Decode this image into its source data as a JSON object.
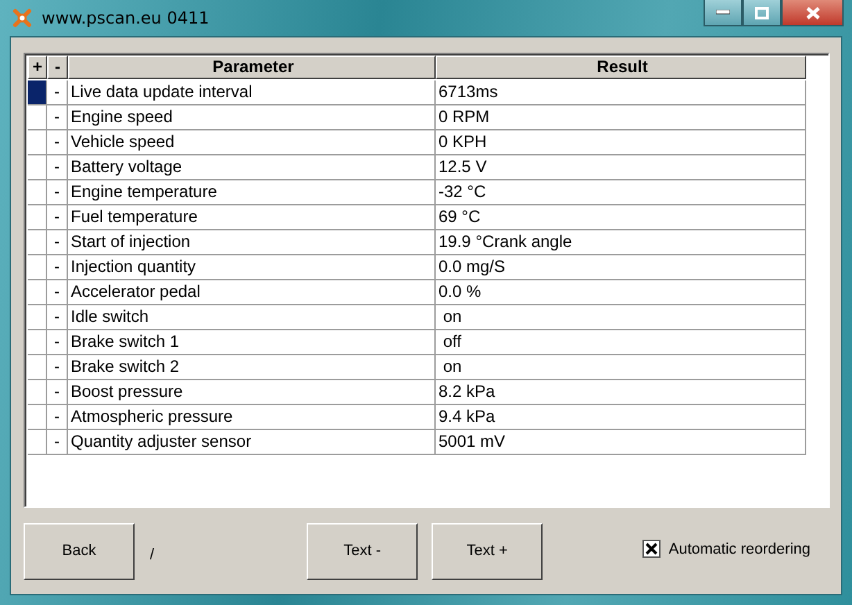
{
  "window": {
    "title": "www.pscan.eu 0411"
  },
  "table": {
    "columns": [
      "+",
      "-",
      "Parameter",
      "Result"
    ],
    "rows": [
      {
        "selected": true,
        "toggle": "-",
        "parameter": "Live data update interval",
        "result": "6713ms"
      },
      {
        "selected": false,
        "toggle": "-",
        "parameter": "Engine speed",
        "result": "0 RPM"
      },
      {
        "selected": false,
        "toggle": "-",
        "parameter": "Vehicle speed",
        "result": "0 KPH"
      },
      {
        "selected": false,
        "toggle": "-",
        "parameter": "Battery voltage",
        "result": "12.5 V"
      },
      {
        "selected": false,
        "toggle": "-",
        "parameter": "Engine temperature",
        "result": "-32 °C"
      },
      {
        "selected": false,
        "toggle": "-",
        "parameter": "Fuel temperature",
        "result": "69 °C"
      },
      {
        "selected": false,
        "toggle": "-",
        "parameter": "Start of injection",
        "result": "19.9 °Crank angle"
      },
      {
        "selected": false,
        "toggle": "-",
        "parameter": "Injection quantity",
        "result": "0.0 mg/S"
      },
      {
        "selected": false,
        "toggle": "-",
        "parameter": "Accelerator pedal",
        "result": "0.0 %"
      },
      {
        "selected": false,
        "toggle": "-",
        "parameter": "Idle switch",
        "result": " on"
      },
      {
        "selected": false,
        "toggle": "-",
        "parameter": "Brake switch 1",
        "result": " off"
      },
      {
        "selected": false,
        "toggle": "-",
        "parameter": "Brake switch 2",
        "result": " on"
      },
      {
        "selected": false,
        "toggle": "-",
        "parameter": "Boost pressure",
        "result": "8.2 kPa"
      },
      {
        "selected": false,
        "toggle": "-",
        "parameter": "Atmospheric pressure",
        "result": "9.4 kPa"
      },
      {
        "selected": false,
        "toggle": "-",
        "parameter": "Quantity adjuster sensor",
        "result": "5001 mV"
      }
    ]
  },
  "buttons": {
    "back": "Back",
    "separator": "/",
    "text_minus": "Text -",
    "text_plus": "Text +"
  },
  "auto_reorder": {
    "label": "Automatic reordering",
    "checked": true
  }
}
